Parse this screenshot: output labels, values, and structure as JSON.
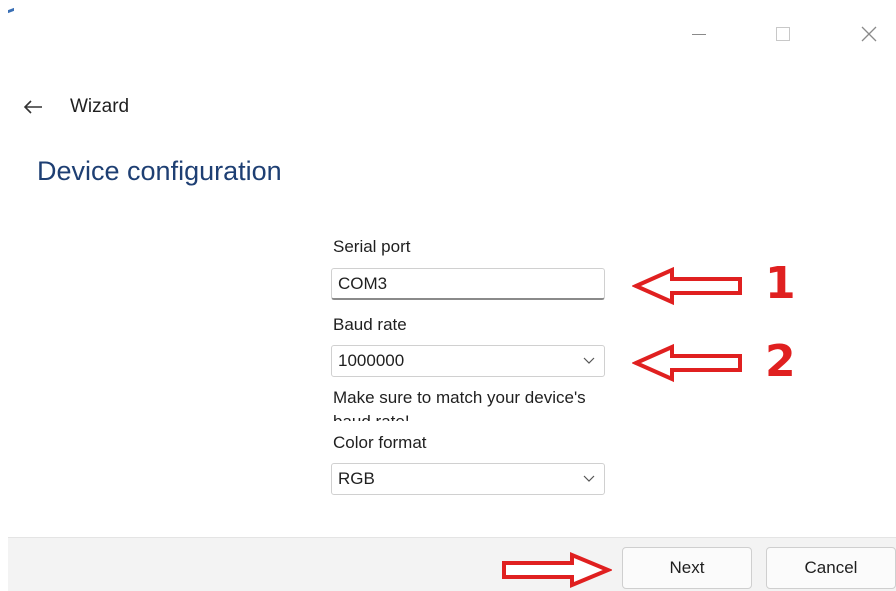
{
  "window": {
    "minimize_icon": "minimize-icon",
    "maximize_icon": "maximize-icon",
    "close_icon": "close-icon"
  },
  "header": {
    "back_label": "Wizard",
    "page_title": "Device configuration"
  },
  "form": {
    "serial_port": {
      "label": "Serial port",
      "value": "COM3"
    },
    "baud_rate": {
      "label": "Baud rate",
      "value": "1000000",
      "hint": "Make sure to match your device's baud rate!"
    },
    "color_format": {
      "label": "Color format",
      "value": "RGB"
    }
  },
  "annotations": {
    "marker_1": "1",
    "marker_2": "2",
    "color": "#e02020"
  },
  "footer": {
    "next_label": "Next",
    "cancel_label": "Cancel"
  },
  "colors": {
    "title": "#1e3f73",
    "footer_bg": "#f3f3f3"
  }
}
